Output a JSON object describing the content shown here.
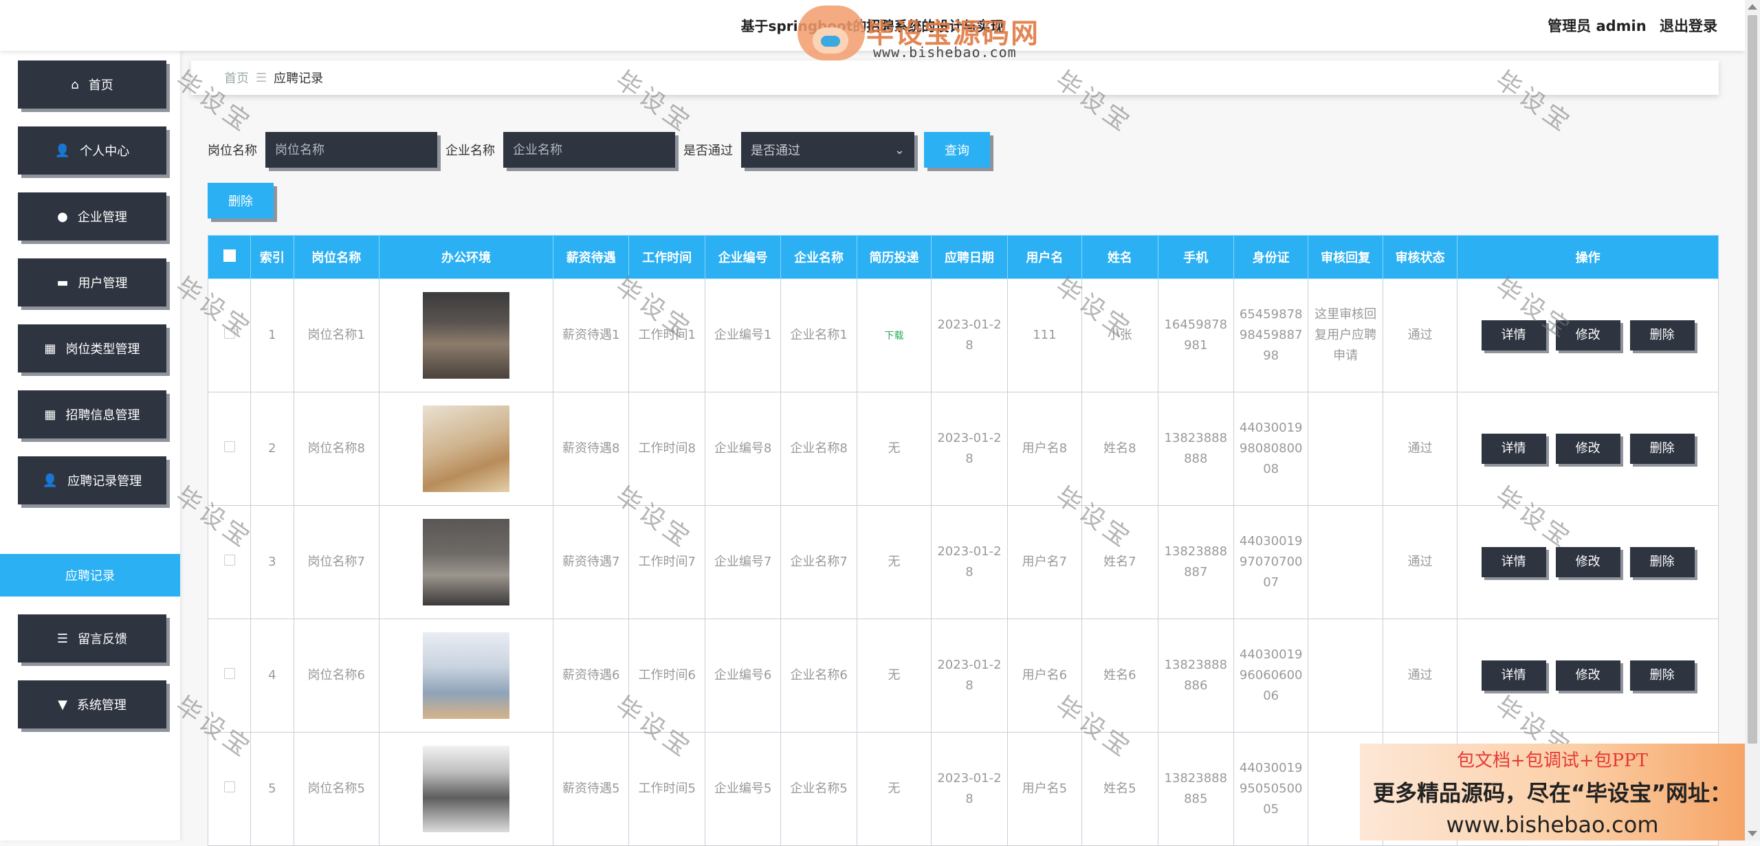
{
  "header": {
    "title": "基于springboot的招聘系统的设计与实现",
    "admin_label": "管理员 admin",
    "logout_label": "退出登录"
  },
  "logo": {
    "name": "毕设宝源码网",
    "url": "www.bishebao.com"
  },
  "sidebar": {
    "items": [
      {
        "label": "首页",
        "icon": "home-icon"
      },
      {
        "label": "个人中心",
        "icon": "user-icon"
      },
      {
        "label": "企业管理",
        "icon": "bulb-icon"
      },
      {
        "label": "用户管理",
        "icon": "device-icon"
      },
      {
        "label": "岗位类型管理",
        "icon": "grid-icon"
      },
      {
        "label": "招聘信息管理",
        "icon": "grid9-icon"
      },
      {
        "label": "应聘记录管理",
        "icon": "user-icon"
      },
      {
        "label": "留言反馈",
        "icon": "sliders-icon"
      },
      {
        "label": "系统管理",
        "icon": "sign-icon"
      }
    ],
    "active_sub": "应聘记录"
  },
  "breadcrumb": {
    "home": "首页",
    "separator": "☰",
    "current": "应聘记录"
  },
  "search": {
    "position_label": "岗位名称",
    "position_placeholder": "岗位名称",
    "company_label": "企业名称",
    "company_placeholder": "企业名称",
    "pass_label": "是否通过",
    "pass_value": "是否通过",
    "query_button": "查询",
    "delete_button": "删除"
  },
  "table": {
    "headers": [
      "索引",
      "岗位名称",
      "办公环境",
      "薪资待遇",
      "工作时间",
      "企业编号",
      "企业名称",
      "简历投递",
      "应聘日期",
      "用户名",
      "姓名",
      "手机",
      "身份证",
      "审核回复",
      "审核状态",
      "操作"
    ],
    "actions": {
      "detail": "详情",
      "edit": "修改",
      "delete": "删除"
    },
    "rows": [
      {
        "index": "1",
        "position": "岗位名称1",
        "salary": "薪资待遇1",
        "work_time": "工作时间1",
        "company_no": "企业编号1",
        "company": "企业名称1",
        "resume": "下载",
        "date": "2023-01-28",
        "username": "111",
        "name": "小张",
        "phone": "16459878981",
        "id_card": "6545987898459887 98",
        "reply": "这里审核回复用户应聘申请",
        "status": "通过",
        "image": "office-industrial"
      },
      {
        "index": "2",
        "position": "岗位名称8",
        "salary": "薪资待遇8",
        "work_time": "工作时间8",
        "company_no": "企业编号8",
        "company": "企业名称8",
        "resume": "无",
        "date": "2023-01-28",
        "username": "用户名8",
        "name": "姓名8",
        "phone": "13823888888",
        "id_card": "440300199808080008",
        "reply": "",
        "status": "通过",
        "image": "office-wood"
      },
      {
        "index": "3",
        "position": "岗位名称7",
        "salary": "薪资待遇7",
        "work_time": "工作时间7",
        "company_no": "企业编号7",
        "company": "企业名称7",
        "resume": "无",
        "date": "2023-01-28",
        "username": "用户名7",
        "name": "姓名7",
        "phone": "13823888887",
        "id_card": "440300199707070007",
        "reply": "",
        "status": "通过",
        "image": "office-grey"
      },
      {
        "index": "4",
        "position": "岗位名称6",
        "salary": "薪资待遇6",
        "work_time": "工作时间6",
        "company_no": "企业编号6",
        "company": "企业名称6",
        "resume": "无",
        "date": "2023-01-28",
        "username": "用户名6",
        "name": "姓名6",
        "phone": "13823888886",
        "id_card": "440300199606060006",
        "reply": "",
        "status": "通过",
        "image": "office-round"
      },
      {
        "index": "5",
        "position": "岗位名称5",
        "salary": "薪资待遇5",
        "work_time": "工作时间5",
        "company_no": "企业编号5",
        "company": "企业名称5",
        "resume": "无",
        "date": "2023-01-28",
        "username": "用户名5",
        "name": "姓名5",
        "phone": "13823888885",
        "id_card": "440300199505050005",
        "reply": "",
        "status": "通过",
        "image": "office-desks"
      }
    ]
  },
  "watermark_text": "毕设宝",
  "ad": {
    "line1": "包文档+包调试+包PPT",
    "line2": "更多精品源码，尽在“毕设宝”网址：",
    "line3": "www.bishebao.com"
  },
  "colors": {
    "accent": "#2ab0f3",
    "dark": "#2e3440",
    "shadow": "#8f949b"
  }
}
